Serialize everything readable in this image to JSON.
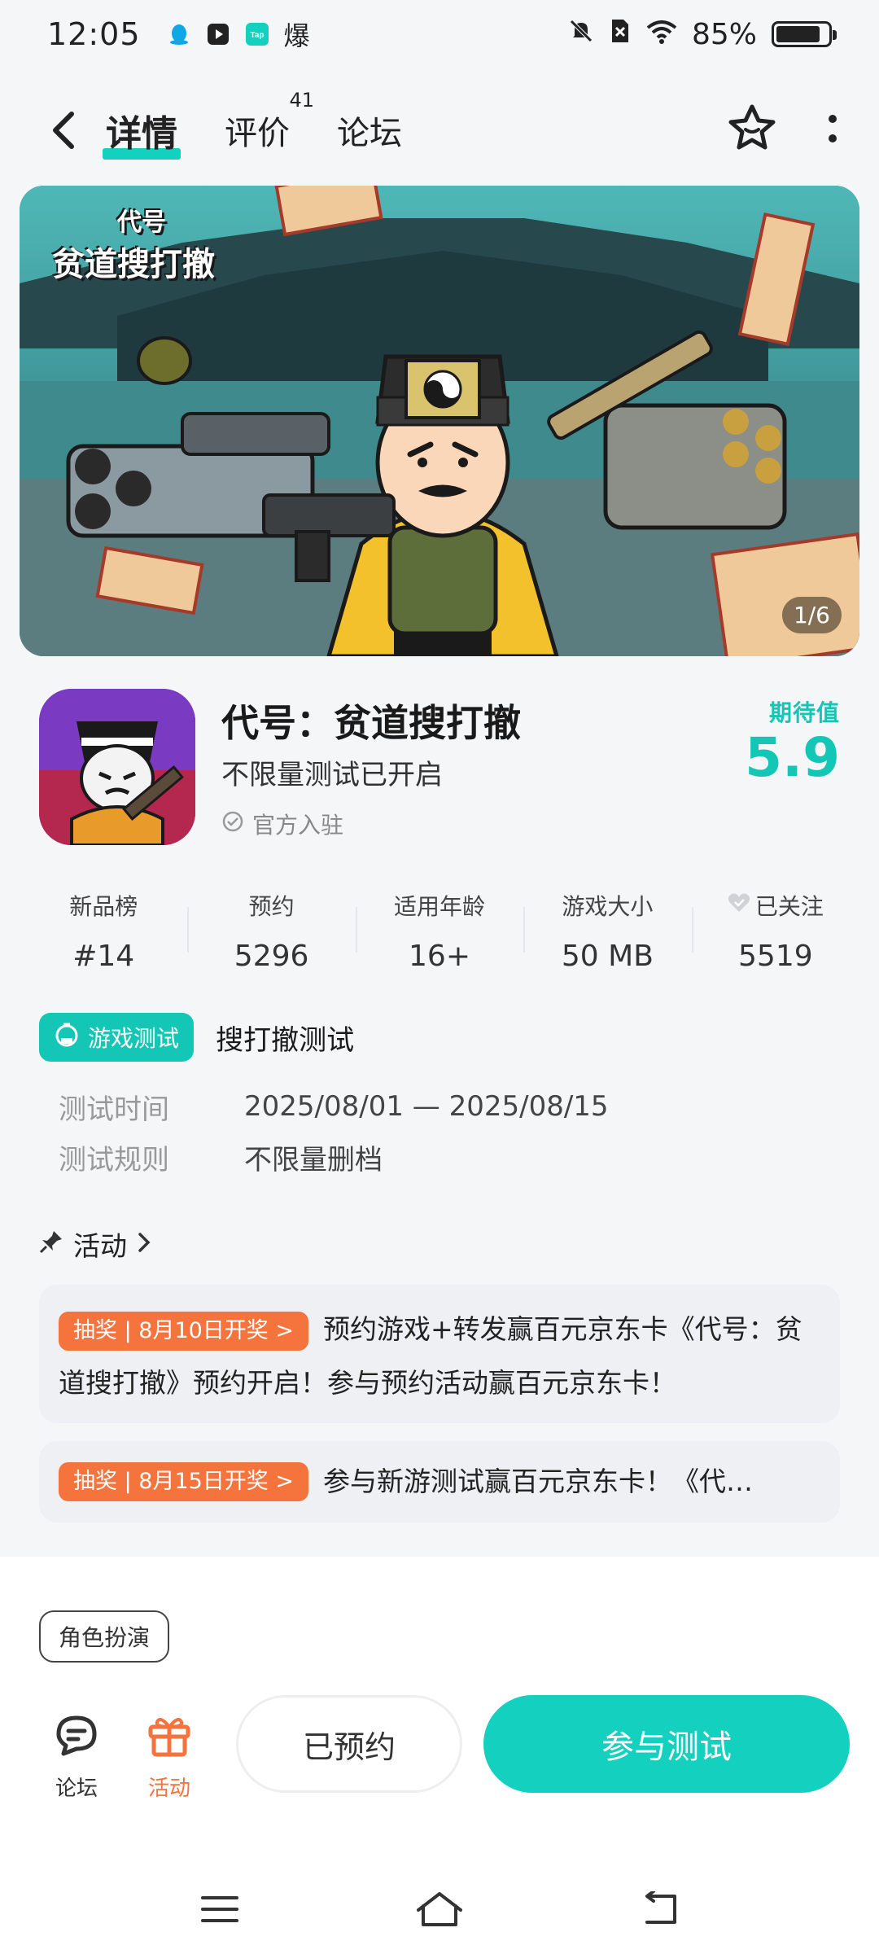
{
  "status_bar": {
    "time": "12:05",
    "apps": [
      "qq-icon",
      "video-icon",
      "taptap-icon",
      "爆"
    ],
    "battery": "85%",
    "battery_level": 0.85
  },
  "nav": {
    "tabs": [
      {
        "label": "详情",
        "active": true
      },
      {
        "label": "评价",
        "count": "41"
      },
      {
        "label": "论坛"
      }
    ]
  },
  "banner": {
    "logo_line1": "代号",
    "logo_line2": "贫道搜打撤",
    "indicator": "1/6"
  },
  "app": {
    "title": "代号：贫道搜打撤",
    "subtitle": "不限量测试已开启",
    "verified": "官方入驻",
    "expect_label": "期待值",
    "expect_value": "5.9"
  },
  "stats": [
    {
      "label": "新品榜",
      "value": "#14"
    },
    {
      "label": "预约",
      "value": "5296"
    },
    {
      "label": "适用年龄",
      "value": "16+"
    },
    {
      "label": "游戏大小",
      "value": "50 MB"
    },
    {
      "label": "已关注",
      "value": "5519"
    }
  ],
  "test": {
    "badge": "游戏测试",
    "title": "搜打撤测试",
    "rows": [
      {
        "key": "测试时间",
        "value": "2025/08/01 — 2025/08/15"
      },
      {
        "key": "测试规则",
        "value": "不限量删档"
      }
    ]
  },
  "activity": {
    "header": "活动",
    "cards": [
      {
        "tag": "抽奖 | 8月10日开奖 >",
        "text": "预约游戏+转发赢百元京东卡《代号：贫道搜打撤》预约开启！参与预约活动赢百元京东卡！"
      },
      {
        "tag": "抽奖 | 8月15日开奖 >",
        "text": "参与新游测试赢百元京东卡！《代…"
      }
    ]
  },
  "genre": "角色扮演",
  "actions": {
    "forum": "论坛",
    "event": "活动",
    "booked": "已预约",
    "join": "参与测试"
  },
  "colors": {
    "accent": "#14d0bf",
    "orange": "#f5733c"
  }
}
